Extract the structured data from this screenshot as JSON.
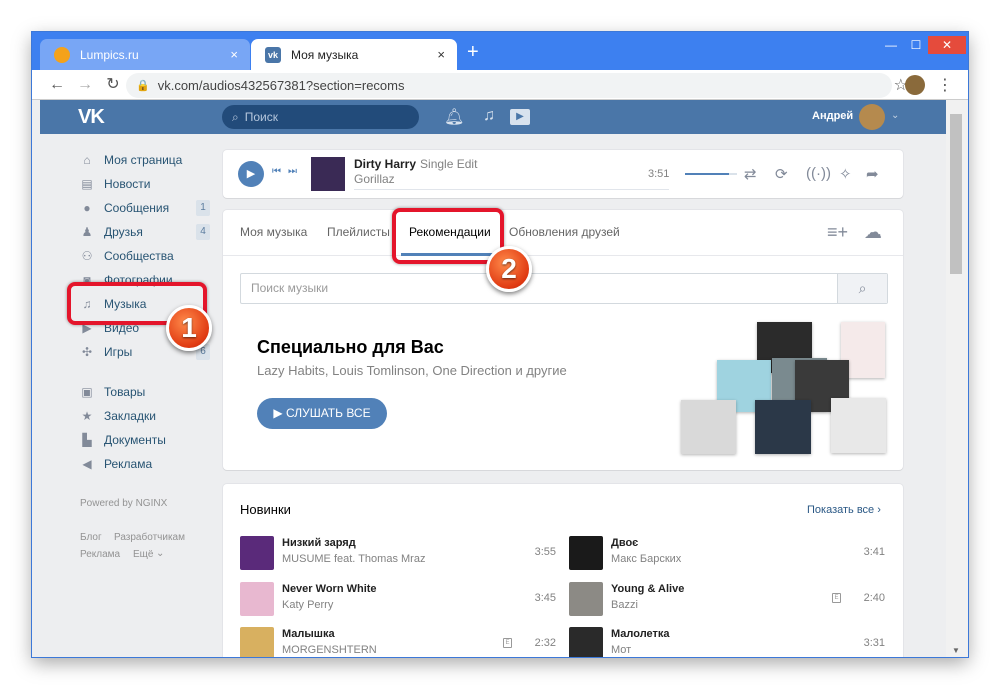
{
  "browser": {
    "tabs": [
      {
        "title": "Lumpics.ru",
        "close": "×"
      },
      {
        "title": "Моя музыка",
        "close": "×"
      }
    ],
    "new_tab": "+",
    "window_controls": {
      "minimize": "—",
      "maximize": "☐",
      "close": "✕"
    },
    "url": "vk.com/audios432567381?section=recoms",
    "nav": {
      "back": "←",
      "forward": "→",
      "reload": "↻"
    },
    "star": "☆",
    "menu": "⋮"
  },
  "vk_header": {
    "logo": "VK",
    "search_placeholder": "Поиск",
    "user_name": "Андрей",
    "icons": [
      "bell-icon",
      "music-note-icon",
      "play-video-icon"
    ]
  },
  "sidebar": {
    "items": [
      {
        "label": "Моя страница",
        "icon": "home-icon",
        "count": ""
      },
      {
        "label": "Новости",
        "icon": "news-icon",
        "count": ""
      },
      {
        "label": "Сообщения",
        "icon": "chat-icon",
        "count": "1"
      },
      {
        "label": "Друзья",
        "icon": "user-icon",
        "count": "4"
      },
      {
        "label": "Сообщества",
        "icon": "group-icon",
        "count": ""
      },
      {
        "label": "Фотографии",
        "icon": "camera-icon",
        "count": ""
      },
      {
        "label": "Музыка",
        "icon": "music-icon",
        "count": ""
      },
      {
        "label": "Видео",
        "icon": "video-icon",
        "count": ""
      },
      {
        "label": "Игры",
        "icon": "gamepad-icon",
        "count": "6"
      },
      {
        "label": "Товары",
        "icon": "bag-icon",
        "count": ""
      },
      {
        "label": "Закладки",
        "icon": "star-icon",
        "count": ""
      },
      {
        "label": "Документы",
        "icon": "document-icon",
        "count": ""
      },
      {
        "label": "Реклама",
        "icon": "megaphone-icon",
        "count": ""
      }
    ],
    "powered": "Powered by NGINX",
    "footer_links": [
      "Блог",
      "Разработчикам",
      "Реклама",
      "Ещё"
    ]
  },
  "player": {
    "title": "Dirty Harry",
    "edition": "Single Edit",
    "artist": "Gorillaz",
    "time": "3:51"
  },
  "music": {
    "tabs": [
      "Моя музыка",
      "Плейлисты",
      "Рекомендации",
      "Обновления друзей"
    ],
    "active_tab": "Рекомендации",
    "search_placeholder": "Поиск музыки",
    "rec_title": "Специально для Вас",
    "rec_subtitle": "Lazy Habits, Louis Tomlinson, One Direction и другие",
    "listen_button": "СЛУШАТЬ ВСЕ"
  },
  "new_releases": {
    "title": "Новинки",
    "show_all": "Показать все",
    "tracks": [
      {
        "name": "Низкий заряд",
        "artist": "MUSUME feat. Thomas Mraz",
        "duration": "3:55",
        "explicit": false
      },
      {
        "name": "Двоє",
        "artist": "Макс Барских",
        "duration": "3:41",
        "explicit": false
      },
      {
        "name": "Never Worn White",
        "artist": "Katy Perry",
        "duration": "3:45",
        "explicit": false
      },
      {
        "name": "Young & Alive",
        "artist": "Bazzi",
        "duration": "2:40",
        "explicit": true
      },
      {
        "name": "Малышка",
        "artist": "MORGENSHTERN",
        "duration": "2:32",
        "explicit": true
      },
      {
        "name": "Малолетка",
        "artist": "Мот",
        "duration": "3:31",
        "explicit": false
      }
    ]
  },
  "annotations": {
    "badge1": "1",
    "badge2": "2"
  },
  "colors": {
    "vk_blue": "#4a76a8",
    "accent": "#5181b8",
    "callout_red": "#e4152b",
    "browser_blue": "#3d80f0"
  }
}
